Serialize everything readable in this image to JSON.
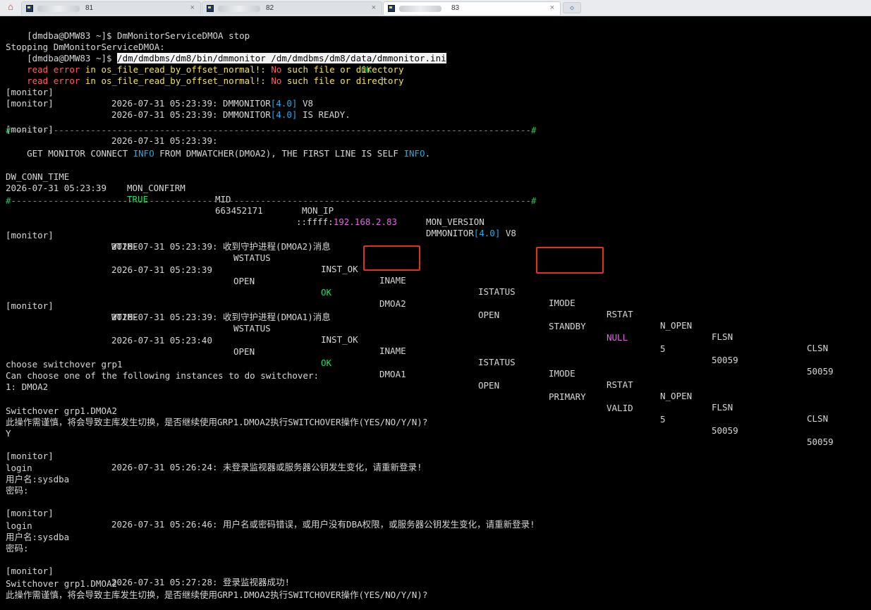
{
  "tabs": [
    {
      "label": "81",
      "active": false
    },
    {
      "label": "82",
      "active": false
    },
    {
      "label": "83",
      "active": true
    }
  ],
  "tab_close_glyph": "×",
  "home_icon": "home-icon",
  "new_tab_icon": "plus-tab-icon",
  "colors": {
    "background": "#000000",
    "text": "#d7d7d7",
    "error": "#ff5f5f",
    "ok": "#29d86a",
    "number": "#2aa8e0",
    "null": "#e066e0",
    "highlight": "#e0302a"
  },
  "terminal": {
    "l1": {
      "a": "[dmdba@DMW83 ~]$ DmMonitorServiceDMOA stop"
    },
    "l2": {
      "a": "Stopping DmMonitorServiceDMOA:",
      "b": "[",
      "c": "OK",
      "d": "]"
    },
    "l3": {
      "a": "[dmdba@DMW83 ~]$ ",
      "b": "/dm/dmdbms/dm8/bin/dmmonitor /dm/dmdbms/dm8/data/dmmonitor.ini"
    },
    "l4": {
      "a": "read error",
      "b": " in os_file_read_by_offset_normal!: ",
      "c": "No",
      "d": " such file or directory"
    },
    "l5": {
      "a": "read error",
      "b": " in os_file_read_by_offset_normal!: ",
      "c": "No",
      "d": " such file or directory"
    },
    "l6": {
      "a": "[monitor]",
      "b": "2026-07-31 05:23:39: DMMONITOR",
      "c": "[4.0]",
      "d": " V8"
    },
    "l7": {
      "a": "[monitor]",
      "b": "2026-07-31 05:23:39: DMMONITOR",
      "c": "[4.0]",
      "d": " IS READY."
    },
    "l8": {
      "a": "[monitor]",
      "b": "2026-07-31 05:23:39:"
    },
    "dashline": "#--------------------------------------------------------------------------------------------------#",
    "l9": {
      "a": "GET MONITOR CONNECT ",
      "b": "INFO",
      "c": " FROM DMWATCHER(DMOA2), THE FIRST LINE IS SELF ",
      "d": "INFO",
      "e": "."
    },
    "conn_header": {
      "c1": "DW_CONN_TIME",
      "c2": "MON_CONFIRM",
      "c3": "MID",
      "c4": "MON_IP",
      "c5": "MON_VERSION"
    },
    "conn_row": {
      "c1": "2026-07-31 05:23:39",
      "c2": "TRUE",
      "c3": "663452171",
      "c4a": "::ffff:",
      "c4b": "192.168.2.83",
      "c5a": "DMMONITOR",
      "c5b": "[4.0]",
      "c5c": " V8"
    },
    "msg1": {
      "a": "[monitor]",
      "b": "2026-07-31 05:23:39: 收到守护进程(DMOA2)消息"
    },
    "inst_header": {
      "wtime": "WTIME",
      "wstatus": "WSTATUS",
      "inst_ok": "INST_OK",
      "iname": "INAME",
      "istatus": "ISTATUS",
      "imode": "IMODE",
      "rstat": "RSTAT",
      "n_open": "N_OPEN",
      "flsn": "FLSN",
      "clsn": "CLSN"
    },
    "inst_row1": {
      "wtime": "2026-07-31 05:23:39",
      "wstatus": "OPEN",
      "inst_ok": "OK",
      "iname": "DMOA2",
      "istatus": "OPEN",
      "imode": "STANDBY",
      "rstat": "NULL",
      "n_open": "5",
      "flsn": "50059",
      "clsn": "50059"
    },
    "msg2": {
      "a": "[monitor]",
      "b": "2026-07-31 05:23:39: 收到守护进程(DMOA1)消息"
    },
    "inst_row2": {
      "wtime": "2026-07-31 05:23:40",
      "wstatus": "OPEN",
      "inst_ok": "OK",
      "iname": "DMOA1",
      "istatus": "OPEN",
      "imode": "PRIMARY",
      "rstat": "VALID",
      "n_open": "5",
      "flsn": "50059",
      "clsn": "50059"
    },
    "s1": "choose switchover grp1",
    "s2": "Can choose one of the following instances to do switchover:",
    "s3": "1: DMOA2",
    "s4": "Switchover grp1.DMOA2",
    "s5": "此操作需谨慎，将会导致主库发生切换，是否继续使用GRP1.DMOA2执行SWITCHOVER操作(YES/NO/Y/N)?",
    "s6": "Y",
    "s7": {
      "a": "[monitor]",
      "b": "2026-07-31 05:26:24: 未登录监视器或服务器公钥发生变化，请重新登录!"
    },
    "s8": "login",
    "s9": "用户名:sysdba",
    "s10": "密码:",
    "s11": {
      "a": "[monitor]",
      "b": "2026-07-31 05:26:46: 用户名或密码错误，或用户没有DBA权限，或服务器公钥发生变化，请重新登录!"
    },
    "s12": "login",
    "s13": "用户名:sysdba",
    "s14": "密码:",
    "s15": {
      "a": "[monitor]",
      "b": "2026-07-31 05:27:28: 登录监视器成功!"
    },
    "s16": "Switchover grp1.DMOA2",
    "s17": "此操作需谨慎，将会导致主库发生切换，是否继续使用GRP1.DMOA2执行SWITCHOVER操作(YES/NO/Y/N)?"
  }
}
